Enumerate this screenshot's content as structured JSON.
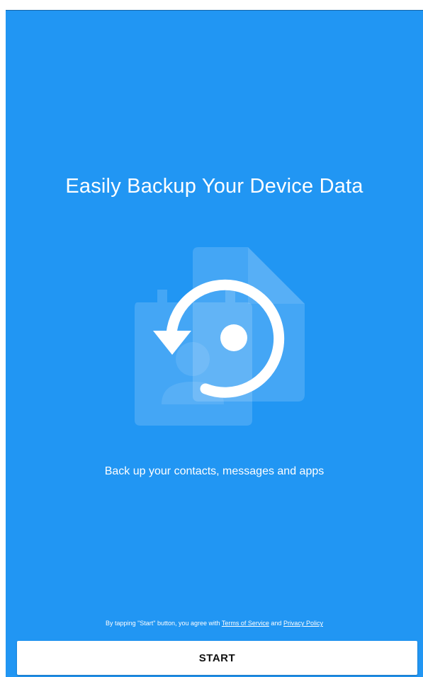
{
  "onboarding": {
    "title": "Easily Backup Your Device Data",
    "subtitle": "Back up your contacts, messages and apps",
    "legal": {
      "prefix": "By tapping \"Start\" button, you agree with ",
      "terms_link": "Terms of Service",
      "connector": " and ",
      "privacy_link": "Privacy Policy"
    },
    "start_button": "START"
  },
  "colors": {
    "background": "#2196F3",
    "text": "#ffffff",
    "button_background": "#ffffff",
    "button_text": "#111111"
  },
  "icons": {
    "illustration": "backup-restore-icon"
  }
}
